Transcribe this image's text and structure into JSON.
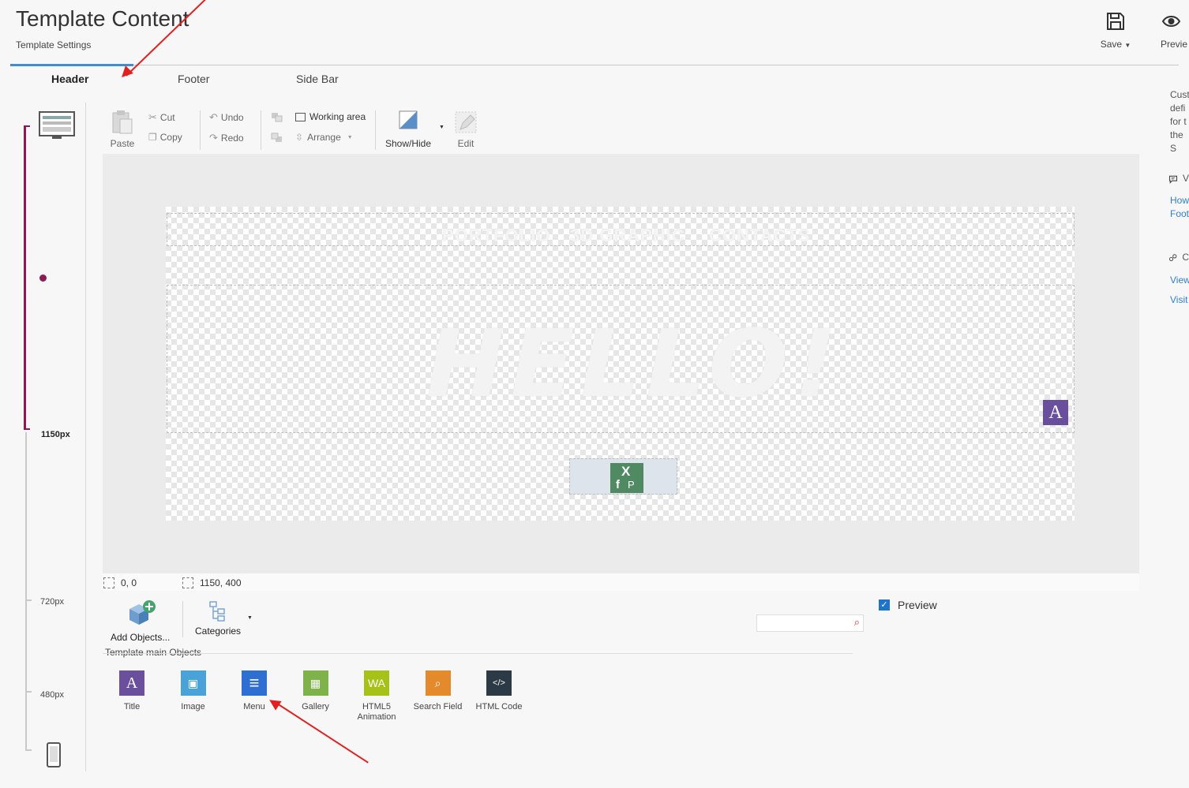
{
  "header": {
    "title": "Template Content",
    "subtitle": "Template Settings"
  },
  "top_actions": {
    "save_label": "Save",
    "preview_label": "Previe"
  },
  "tabs": [
    {
      "label": "Header",
      "active": true
    },
    {
      "label": "Footer",
      "active": false
    },
    {
      "label": "Side Bar",
      "active": false
    }
  ],
  "right_panel": {
    "lines": [
      "Cust",
      "defi",
      "for t",
      "the S"
    ],
    "section1_char": "V",
    "links1": [
      "How",
      "Foot"
    ],
    "section2_char": "C",
    "links2": [
      "View",
      "Visit"
    ]
  },
  "breakpoints": {
    "desktop": "1150px",
    "tablet": "720px",
    "mobile": "480px"
  },
  "toolbar": {
    "paste": "Paste",
    "cut": "Cut",
    "copy": "Copy",
    "undo": "Undo",
    "redo": "Redo",
    "working_area": "Working area",
    "arrange": "Arrange",
    "show_hide": "Show/Hide",
    "edit": "Edit"
  },
  "canvas": {
    "menu_items": [
      "PORTFOLIO",
      "3D GRAPHIC",
      "CONTACTS"
    ],
    "hero_text": "HELLO!",
    "badge_letter": "A",
    "social_letters": {
      "x": "X",
      "f": "f",
      "p": "P"
    }
  },
  "status": {
    "position": "0, 0",
    "size": "1150, 400"
  },
  "objects_panel": {
    "add_objects": "Add Objects...",
    "categories": "Categories",
    "preview_label": "Preview",
    "preview_checked": true,
    "search_placeholder": "",
    "section_title": "Template main Objects",
    "items": [
      {
        "label": "Title",
        "color": "#6a4f9c",
        "glyph": "A"
      },
      {
        "label": "Image",
        "color": "#4aa3d8",
        "glyph": "▣"
      },
      {
        "label": "Menu",
        "color": "#2f6fd1",
        "glyph": "≡"
      },
      {
        "label": "Gallery",
        "color": "#7fb24a",
        "glyph": "▦"
      },
      {
        "label": "HTML5\nAnimation",
        "color": "#a6c219",
        "glyph": "WA"
      },
      {
        "label": "Search Field",
        "color": "#e38a2d",
        "glyph": "⌕"
      },
      {
        "label": "HTML Code",
        "color": "#2b3a44",
        "glyph": "</>"
      }
    ]
  }
}
